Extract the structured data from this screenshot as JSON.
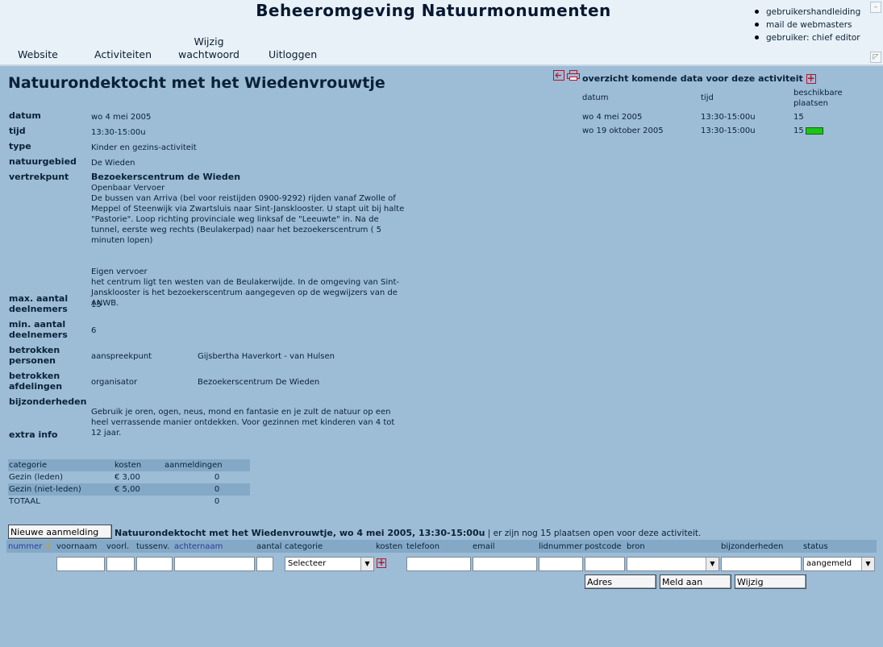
{
  "app": {
    "title": "Beheeromgeving Natuurmonumenten"
  },
  "nav": {
    "website": "Website",
    "activiteiten": "Activiteiten",
    "wijzig_1": "Wijzig",
    "wijzig_2": "wachtwoord",
    "uitloggen": "Uitloggen"
  },
  "user_links": [
    "gebruikershandleiding",
    "mail de webmasters",
    "gebruiker: chief editor"
  ],
  "scrollbar": {
    "up": "–",
    "resize": "◸"
  },
  "activity": {
    "title": "Natuurondektocht met het Wiedenvrouwtje",
    "fields": {
      "datum_label": "datum",
      "datum": "wo 4 mei 2005",
      "tijd_label": "tijd",
      "tijd": "13:30-15:00u",
      "type_label": "type",
      "type": "Kinder en gezins-activiteit",
      "natuurgebied_label": "natuurgebied",
      "natuurgebied": "De Wieden",
      "vertrekpunt_label": "vertrekpunt",
      "vertrekpunt_title": "Bezoekerscentrum de Wieden",
      "vertrekpunt_ov_head": "Openbaar Vervoer",
      "vertrekpunt_ov": "De bussen van Arriva (bel voor reistijden 0900-9292) rijden vanaf Zwolle of Meppel of Steenwijk via Zwartsluis naar Sint-Jansklooster. U stapt uit bij halte \"Pastorie\". Loop richting provinciale weg linksaf de \"Leeuwte\" in. Na de tunnel, eerste weg rechts (Beulakerpad) naar het bezoekerscentrum ( 5 minuten lopen)",
      "vertrekpunt_eigen_head": "Eigen vervoer",
      "vertrekpunt_eigen": "het centrum ligt ten westen van de Beulakerwijde. In de omgeving van Sint-Jansklooster is het bezoekerscentrum aangegeven op de wegwijzers van de ANWB.",
      "max_label_1": "max. aantal",
      "max_label_2": "deelnemers",
      "max": "15",
      "min_label_1": "min. aantal",
      "min_label_2": "deelnemers",
      "min": "6",
      "personen_label_1": "betrokken",
      "personen_label_2": "personen",
      "personen_role": "aanspreekpunt",
      "personen_name": "Gijsbertha Haverkort - van Hulsen",
      "afdelingen_label_1": "betrokken",
      "afdelingen_label_2": "afdelingen",
      "afdelingen_role": "organisator",
      "afdelingen_name": "Bezoekerscentrum De Wieden",
      "bijzonderheden_label": "bijzonderheden",
      "bijzonderheden": "Gebruik je oren, ogen, neus, mond en fantasie en je zult de natuur op een heel verrassende manier ontdekken. Voor gezinnen met kinderen van 4 tot 12 jaar.",
      "extra_label": "extra info"
    }
  },
  "costs": {
    "headers": [
      "categorie",
      "kosten",
      "aanmeldingen"
    ],
    "rows": [
      [
        "Gezin (leden)",
        "€ 3,00",
        "0"
      ],
      [
        "Gezin (niet-leden)",
        "€ 5,00",
        "0"
      ],
      [
        "TOTAAL",
        "",
        "0"
      ]
    ]
  },
  "overview": {
    "title": "overzicht komende data voor deze activiteit",
    "col_datum": "datum",
    "col_tijd": "tijd",
    "col_plaatsen_1": "beschikbare",
    "col_plaatsen_2": "plaatsen",
    "rows": [
      {
        "datum": "wo 4 mei 2005",
        "tijd": "13:30-15:00u",
        "plaatsen": "15"
      },
      {
        "datum": "wo 19 oktober 2005",
        "tijd": "13:30-15:00u",
        "plaatsen": "15"
      }
    ]
  },
  "registration": {
    "new_button": "Nieuwe aanmelding",
    "info_bold": "Natuurondektocht met het Wiedenvrouwtje, wo 4 mei 2005, 13:30-15:00u",
    "info_rest": " | er zijn nog 15 plaatsen open voor deze activiteit.",
    "headers": {
      "nummer": "nummer",
      "voornaam": "voornaam",
      "voorl": "voorl.",
      "tussenv": "tussenv.",
      "achternaam": "achternaam",
      "aantal": "aantal",
      "categorie": "categorie",
      "kosten": "kosten",
      "telefoon": "telefoon",
      "email": "email",
      "lidnummer": "lidnummer",
      "postcode": "postcode",
      "bron": "bron",
      "bijzonderheden": "bijzonderheden",
      "status": "status"
    },
    "categorie_value": "Selecteer",
    "bron_value": "",
    "status_value": "aangemeld",
    "adres_button": "Adres",
    "meld_aan_button": "Meld aan",
    "wijzig_button": "Wijzig"
  },
  "colors": {
    "background": "#9dbcd6",
    "topbar": "#e8f1f7",
    "row_shade": "#84a9c7",
    "accent_red": "#c0102a",
    "badge_green": "#1cc418"
  }
}
